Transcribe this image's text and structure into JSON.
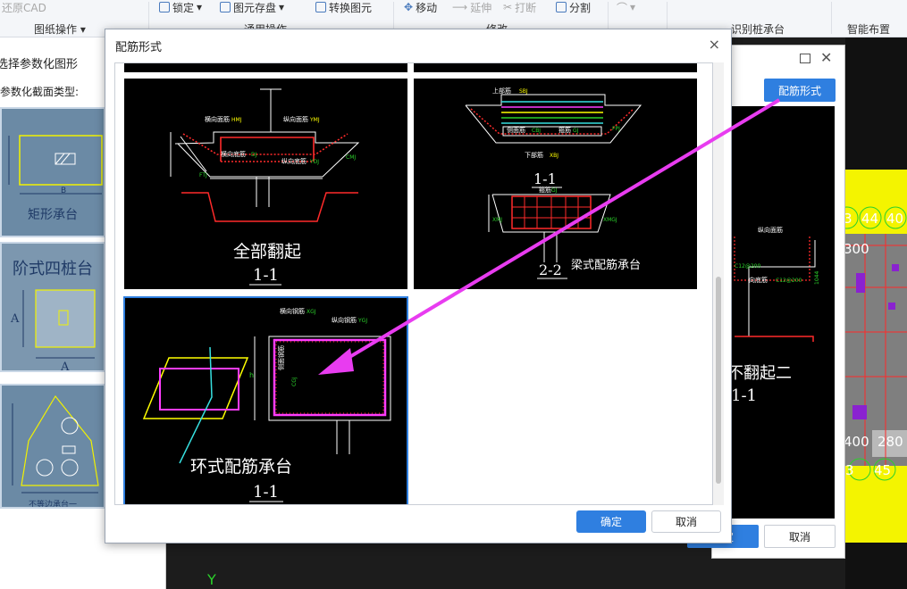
{
  "ribbon": {
    "tools": {
      "restore_cad": "还原CAD",
      "lock": "锁定",
      "save_element": "图元存盘",
      "convert_element": "转换图元",
      "move": "移动",
      "extend": "延伸",
      "break": "打断",
      "split": "分割",
      "smart_layout": "智能布置"
    },
    "groups": {
      "drawing_ops": "图纸操作",
      "general_ops": "通用操作",
      "modify": "修改",
      "identify_cap": "识别桩承台",
      "smart_layout": "智能布置"
    }
  },
  "left_panel": {
    "title": "选择参数化图形",
    "section_label": "参数化截面类型:",
    "thumbs": [
      {
        "caption": "矩形承台"
      },
      {
        "caption": "阶式四桩台"
      },
      {
        "caption": "不等边承台一"
      }
    ],
    "labels": {
      "A": "A",
      "B": "B"
    }
  },
  "back_dialog": {
    "rebar_form_button": "配筋形式",
    "ok_label": "确定",
    "cancel_label": "取消",
    "caption": "不翻起二",
    "section": "1-1",
    "rebar_labels": [
      "纵向面筋",
      "向底筋",
      "C12@200",
      "C12@200",
      "1044"
    ]
  },
  "right_cad": {
    "labels": [
      "3",
      "44",
      "40",
      "300",
      "400",
      "280",
      "3",
      "45"
    ]
  },
  "dialog": {
    "title": "配筋形式",
    "close": "×",
    "ok_label": "确定",
    "cancel_label": "取消",
    "options": [
      {
        "caption": "全部翻起",
        "section": "1-1",
        "labels": {
          "horizontal_top": "横向面筋",
          "horizontal_top_code": "HMJ",
          "longitudinal_top": "纵向面筋",
          "longitudinal_top_code": "YMJ",
          "horizontal_bottom": "横向底筋",
          "horizontal_bottom_code": "DJ",
          "longitudinal_bottom": "纵向底筋",
          "longitudinal_bottom_code": "YDJ",
          "side": "CMJ",
          "ext": "FTJ"
        }
      },
      {
        "caption": "梁式配筋承台",
        "section_a": "1-1",
        "section_b": "2-2",
        "labels": {
          "top_rebar": "上部筋",
          "top_code": "SBJ",
          "bottom_rebar": "下部筋",
          "bottom_code": "XBJ",
          "side": "侧面筋",
          "side_code": "CBJ",
          "stirrup": "箍筋",
          "stirrup_code": "GJ",
          "ext": "FPJ",
          "waist": "XMJ",
          "xmgj": "XMGJ"
        }
      },
      {
        "caption": "环式配筋承台",
        "section": "1-1",
        "labels": {
          "horizontal": "横向钢筋",
          "horizontal_code": "XGJ",
          "longitudinal": "纵向钢筋",
          "longitudinal_code": "YGJ",
          "side": "侧面钢筋",
          "side_code": "CGJ",
          "h": "h"
        }
      }
    ]
  },
  "colors": {
    "accent": "#2f7fe0",
    "arrow": "#e83cf0",
    "cad_bg": "#000000",
    "rebar_red": "#ff2a2a",
    "dim_green": "#2bd12b",
    "line_white": "#ffffff",
    "yellow": "#ffff00",
    "magenta": "#ff3cff",
    "cyan": "#37e0e0"
  }
}
